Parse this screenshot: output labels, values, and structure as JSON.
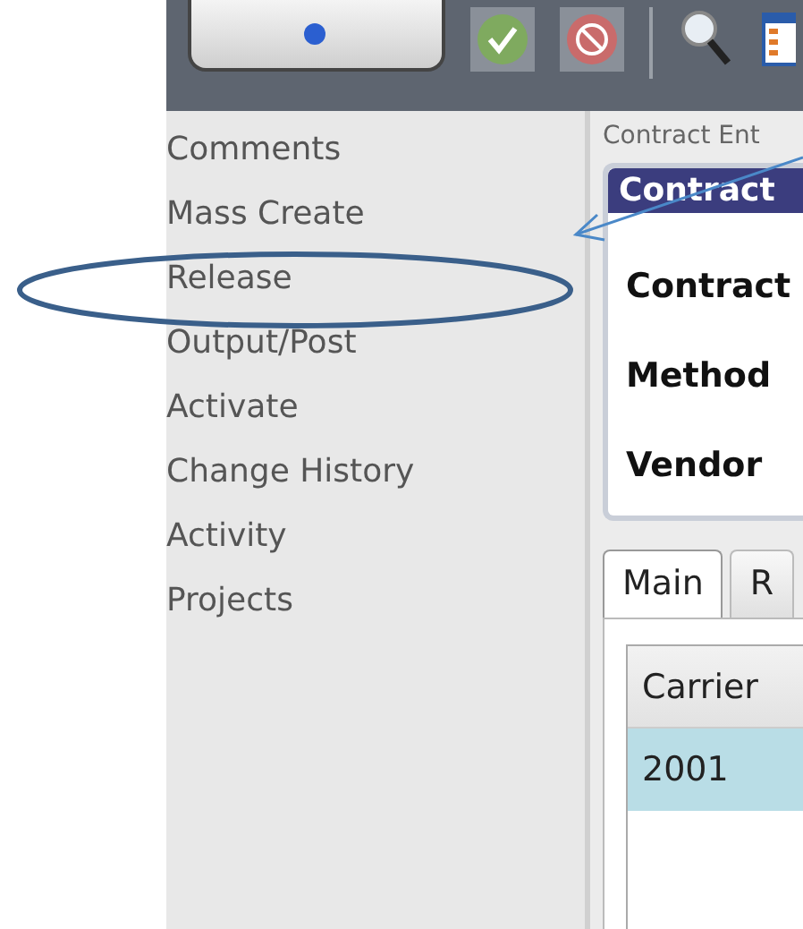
{
  "toolbar": {
    "buttons": [
      {
        "kind": "large"
      },
      {
        "kind": "approve"
      },
      {
        "kind": "cancel"
      },
      {
        "kind": "search"
      },
      {
        "kind": "table"
      }
    ]
  },
  "sidebar": {
    "items": [
      "Comments",
      "Mass Create",
      "Release",
      "Output/Post",
      "Activate",
      "Change History",
      "Activity",
      "Projects"
    ]
  },
  "breadcrumb": "Contract Ent",
  "card": {
    "title": "Contract",
    "fields": [
      "Contract",
      "Method",
      "Vendor"
    ]
  },
  "tabs": [
    {
      "label": "Main",
      "selected": true
    },
    {
      "label": "R",
      "selected": false
    }
  ],
  "table": {
    "columns": [
      "Carrier"
    ],
    "rows": [
      {
        "cells": [
          "2001"
        ],
        "selected": true
      }
    ]
  }
}
